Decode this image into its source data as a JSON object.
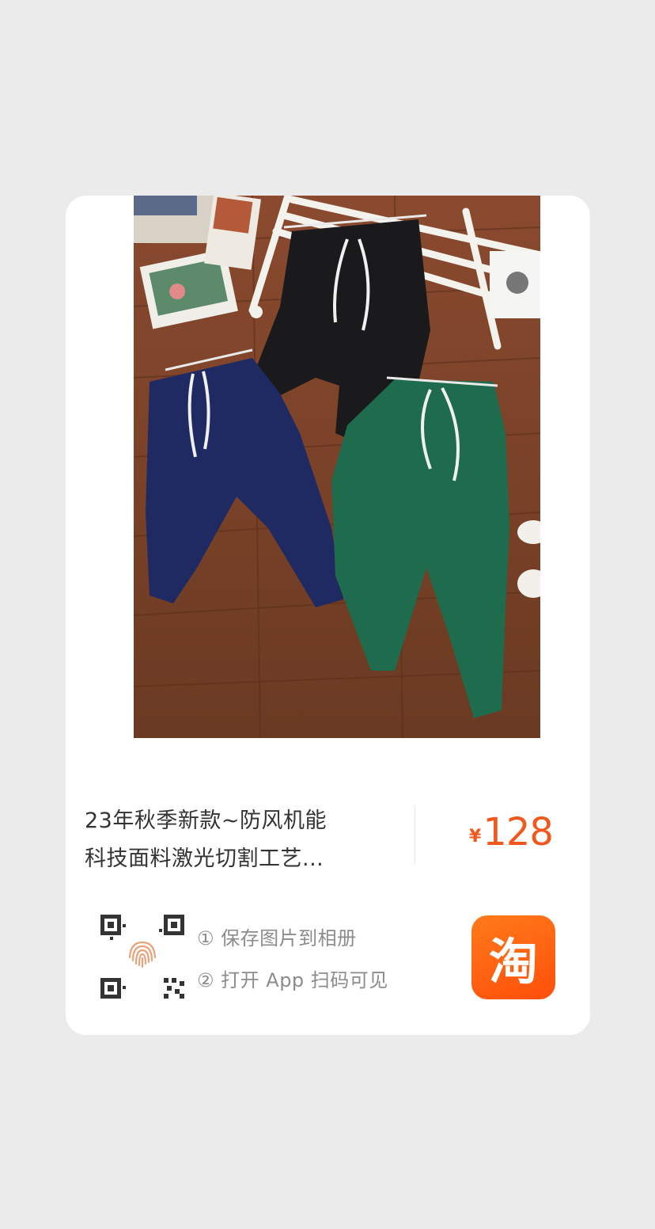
{
  "product": {
    "image_alt": "navy-black-green-jogger-pants-photo",
    "title": "23年秋季新款~防风机能\n科技面料激光切割工艺...",
    "currency": "¥",
    "price": "128"
  },
  "instructions": {
    "step1": "① 保存图片到相册",
    "step2": "② 打开 App 扫码可见"
  },
  "logo": {
    "glyph": "淘"
  },
  "colors": {
    "page_bg": "#ebebeb",
    "card_bg": "#ffffff",
    "price": "#f2571c",
    "logo_orange": "#ff5a0f"
  },
  "icons": [
    "qr-code-icon",
    "fingerprint-icon",
    "taobao-logo"
  ]
}
